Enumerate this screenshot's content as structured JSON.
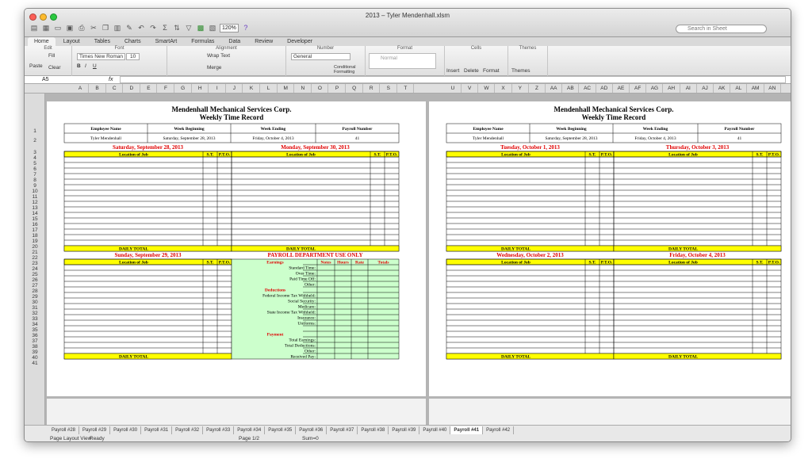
{
  "window": {
    "title": "2013 – Tyler Mendenhall.xlsm"
  },
  "toolbar": {
    "zoom": "120%",
    "search_placeholder": "Search in Sheet"
  },
  "ribbon": {
    "tabs": [
      "Home",
      "Layout",
      "Tables",
      "Charts",
      "SmartArt",
      "Formulas",
      "Data",
      "Review",
      "Developer"
    ],
    "groups": [
      "Edit",
      "Font",
      "Alignment",
      "Number",
      "Format",
      "Cells",
      "Themes"
    ],
    "fill": "Fill",
    "clear": "Clear",
    "paste": "Paste",
    "font_name": "Times New Roman",
    "font_size": "10",
    "wrap_text": "Wrap Text",
    "merge": "Merge",
    "number_format": "General",
    "style_normal": "Normal",
    "conditional": "Conditional\nFormatting",
    "insert": "Insert",
    "delete": "Delete",
    "format": "Format",
    "themes": "Themes"
  },
  "formula_bar": {
    "cell_ref": "A5",
    "fx": "fx"
  },
  "columns_left": [
    "A",
    "B",
    "C",
    "D",
    "E",
    "F",
    "G",
    "H",
    "I",
    "J",
    "K",
    "L",
    "M",
    "N",
    "O",
    "P",
    "Q",
    "R",
    "S",
    "T"
  ],
  "columns_right": [
    "U",
    "V",
    "W",
    "X",
    "Y",
    "Z",
    "AA",
    "AB",
    "AC",
    "AD",
    "AE",
    "AF",
    "AG",
    "AH",
    "AI",
    "AJ",
    "AK",
    "AL",
    "AM",
    "AN"
  ],
  "rows": [
    "1",
    "2",
    "3",
    "4",
    "5",
    "6",
    "7",
    "8",
    "9",
    "10",
    "11",
    "12",
    "13",
    "14",
    "15",
    "16",
    "17",
    "18",
    "19",
    "20",
    "21",
    "22",
    "23",
    "24",
    "25",
    "26",
    "27",
    "28",
    "29",
    "30",
    "31",
    "32",
    "33",
    "34",
    "35",
    "36",
    "37",
    "38",
    "39",
    "40",
    "41"
  ],
  "form": {
    "company": "Mendenhall Mechanical Services Corp.",
    "subtitle": "Weekly Time Record",
    "headers": [
      "Employee Name",
      "Week Beginning",
      "Week Ending",
      "Payroll Number"
    ],
    "values": [
      "Tyler Mendenhall",
      "Saturday, September 28, 2013",
      "Friday, October 4, 2013",
      "41"
    ],
    "days_left_top": [
      "Saturday, September 28, 2013",
      "Monday, September 30, 2013"
    ],
    "days_left_bottom": [
      "Sunday, September 29, 2013",
      "PAYROLL DEPARTMENT USE ONLY"
    ],
    "days_right_top": [
      "Tuesday, October 1, 2013",
      "Thursday, October 3, 2013"
    ],
    "days_right_bottom": [
      "Wednesday, October 2, 2013",
      "Friday, October 4, 2013"
    ],
    "col_location": "Location of Job",
    "col_st": "S.T.",
    "col_pto": "P.T.O.",
    "daily_total": "DAILY TOTAL",
    "payroll_cols": [
      "Earnings",
      "Notes",
      "Hours",
      "Rate",
      "Totals"
    ],
    "earnings": [
      "Standard Time:",
      "Over Time:",
      "Paid Time Off:",
      "Other:"
    ],
    "deductions_label": "Deductions",
    "deductions": [
      "Federal Income Tax Withheld:",
      "Social Security:",
      "Medicare:",
      "State Income Tax Withheld:",
      "Insurance:",
      "Uniforms:"
    ],
    "payment_label": "Payment",
    "payment": [
      "Total Earnings:",
      "Total Deductions:",
      "Other:",
      "Received Pay:"
    ]
  },
  "sheet_tabs": [
    "Payroll #28",
    "Payroll #29",
    "Payroll #30",
    "Payroll #31",
    "Payroll #32",
    "Payroll #33",
    "Payroll #34",
    "Payroll #35",
    "Payroll #36",
    "Payroll #37",
    "Payroll #38",
    "Payroll #39",
    "Payroll #40",
    "Payroll #41",
    "Payroll #42"
  ],
  "active_sheet": "Payroll #41",
  "status": {
    "view": "Page Layout View",
    "state": "Ready",
    "page": "Page 1/2",
    "sum": "Sum=0"
  },
  "colors": {
    "yellow": "#ffff00",
    "green": "#ccffcc",
    "red_text": "#e00000"
  }
}
